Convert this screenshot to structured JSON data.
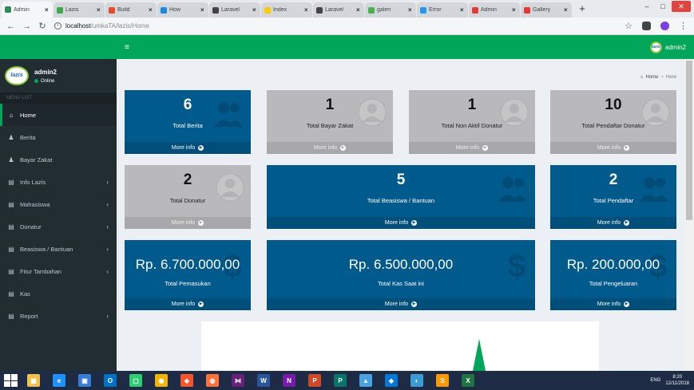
{
  "browser": {
    "tabs": [
      {
        "title": "Admin",
        "active": true,
        "favicon_color": "#2e8b57"
      },
      {
        "title": "Lazis",
        "active": false,
        "favicon_color": "#3aaa4a"
      },
      {
        "title": "Build",
        "active": false,
        "favicon_color": "#e34c26"
      },
      {
        "title": "How",
        "active": false,
        "favicon_color": "#1e88e5"
      },
      {
        "title": "Laravel",
        "active": false,
        "favicon_color": "#444444"
      },
      {
        "title": "Index",
        "active": false,
        "favicon_color": "#ffcc00"
      },
      {
        "title": "Laravel",
        "active": false,
        "favicon_color": "#444444"
      },
      {
        "title": "galeri",
        "active": false,
        "favicon_color": "#4caf50"
      },
      {
        "title": "Error",
        "active": false,
        "favicon_color": "#2196f3"
      },
      {
        "title": "Admin",
        "active": false,
        "favicon_color": "#e53935"
      },
      {
        "title": "Gallery",
        "active": false,
        "favicon_color": "#e53935"
      }
    ],
    "newtab_icon": "plus-icon",
    "url_host": "localhost",
    "url_path": "/umkaTA/lazis/Home",
    "window_controls": {
      "minimize": "–",
      "maximize": "□",
      "close": "✕"
    }
  },
  "header": {
    "menu_icon": "hamburger-icon",
    "user_name": "admin2",
    "logo_text": "lazis"
  },
  "sidebar": {
    "user": {
      "name": "admin2",
      "status": "Online"
    },
    "menu_header": "MENU LIST",
    "items": [
      {
        "label": "Home",
        "icon": "home-icon",
        "glyph": "⌂",
        "active": true,
        "has_arrow": false
      },
      {
        "label": "Berita",
        "icon": "user-icon",
        "glyph": "♟",
        "active": false,
        "has_arrow": false
      },
      {
        "label": "Bayar Zakat",
        "icon": "user-icon",
        "glyph": "♟",
        "active": false,
        "has_arrow": false
      },
      {
        "label": "Info Lazis",
        "icon": "document-icon",
        "glyph": "▤",
        "active": false,
        "has_arrow": true
      },
      {
        "label": "Mahasiswa",
        "icon": "document-icon",
        "glyph": "▤",
        "active": false,
        "has_arrow": true
      },
      {
        "label": "Donatur",
        "icon": "document-icon",
        "glyph": "▤",
        "active": false,
        "has_arrow": true
      },
      {
        "label": "Beasiswa / Bantuan",
        "icon": "document-icon",
        "glyph": "▤",
        "active": false,
        "has_arrow": true
      },
      {
        "label": "Fitur Tambahan",
        "icon": "document-icon",
        "glyph": "▤",
        "active": false,
        "has_arrow": true
      },
      {
        "label": "Kas",
        "icon": "document-icon",
        "glyph": "▤",
        "active": false,
        "has_arrow": false
      },
      {
        "label": "Report",
        "icon": "document-icon",
        "glyph": "▤",
        "active": false,
        "has_arrow": true
      }
    ]
  },
  "breadcrumb": {
    "home": "Home",
    "current": "Here"
  },
  "boxes": [
    {
      "value": "6",
      "label": "Total Berita",
      "footer": "More info",
      "color": "blue",
      "icon": "users-icon"
    },
    {
      "value": "1",
      "label": "Total Bayar Zakat",
      "footer": "More info",
      "color": "grey",
      "icon": "user-avatar-icon"
    },
    {
      "value": "1",
      "label": "Total Non Aktif Donatur",
      "footer": "More info",
      "color": "grey",
      "icon": "user-avatar-icon"
    },
    {
      "value": "10",
      "label": "Total Pendaftar Donatur",
      "footer": "More info",
      "color": "grey",
      "icon": "user-avatar-icon"
    },
    {
      "value": "2",
      "label": "Total Donatur",
      "footer": "More info",
      "color": "grey",
      "icon": "user-avatar-icon"
    },
    {
      "value": "5",
      "label": "Total Beasiswa / Bantuan",
      "footer": "More info",
      "color": "blue",
      "icon": "users-icon"
    },
    {
      "value": "2",
      "label": "Total Pendaftar",
      "footer": "More info",
      "color": "blue",
      "icon": "users-icon"
    }
  ],
  "money_boxes": [
    {
      "value": "Rp. 6.700.000,00",
      "label": "Total Pemasukan",
      "footer": "More info",
      "icon": "dollar-icon"
    },
    {
      "value": "Rp. 6.500.000,00",
      "label": "Total Kas Saat ini",
      "footer": "More info",
      "icon": "dollar-icon"
    },
    {
      "value": "Rp. 200.000,00",
      "label": "Total Pengeluaran",
      "footer": "More info",
      "icon": "dollar-icon"
    }
  ],
  "colors": {
    "primary_green": "#00a65a",
    "sidebar_bg": "#222d32",
    "box_blue": "#005a8c",
    "box_grey": "#b9b9bb",
    "content_bg": "#ecf0f5"
  },
  "taskbar": {
    "apps": [
      {
        "name": "file-explorer",
        "glyph": "▦",
        "color": "#f3c14b"
      },
      {
        "name": "internet-explorer",
        "glyph": "e",
        "color": "#1e90ff"
      },
      {
        "name": "control-panel",
        "glyph": "▣",
        "color": "#3a7bd5"
      },
      {
        "name": "outlook",
        "glyph": "O",
        "color": "#0072c6"
      },
      {
        "name": "terminal",
        "glyph": "▢",
        "color": "#2ecc71"
      },
      {
        "name": "chrome",
        "glyph": "◉",
        "color": "#f4b400"
      },
      {
        "name": "brave",
        "glyph": "◈",
        "color": "#fb542b"
      },
      {
        "name": "firefox",
        "glyph": "◍",
        "color": "#ff7139"
      },
      {
        "name": "visual-studio",
        "glyph": "⋈",
        "color": "#68217a"
      },
      {
        "name": "word",
        "glyph": "W",
        "color": "#2b579a"
      },
      {
        "name": "onenote",
        "glyph": "N",
        "color": "#7719aa"
      },
      {
        "name": "powerpoint",
        "glyph": "P",
        "color": "#d24726"
      },
      {
        "name": "publisher",
        "glyph": "P",
        "color": "#077568"
      },
      {
        "name": "photos",
        "glyph": "▲",
        "color": "#4aa3df"
      },
      {
        "name": "vscode",
        "glyph": "◆",
        "color": "#0078d7"
      },
      {
        "name": "paint",
        "glyph": "◐",
        "color": "#3c9bd6"
      },
      {
        "name": "sublime",
        "glyph": "S",
        "color": "#ff9800"
      },
      {
        "name": "excel",
        "glyph": "X",
        "color": "#217346"
      }
    ],
    "tray_text": "ENG",
    "time": "8:20",
    "date": "12/11/2018"
  }
}
